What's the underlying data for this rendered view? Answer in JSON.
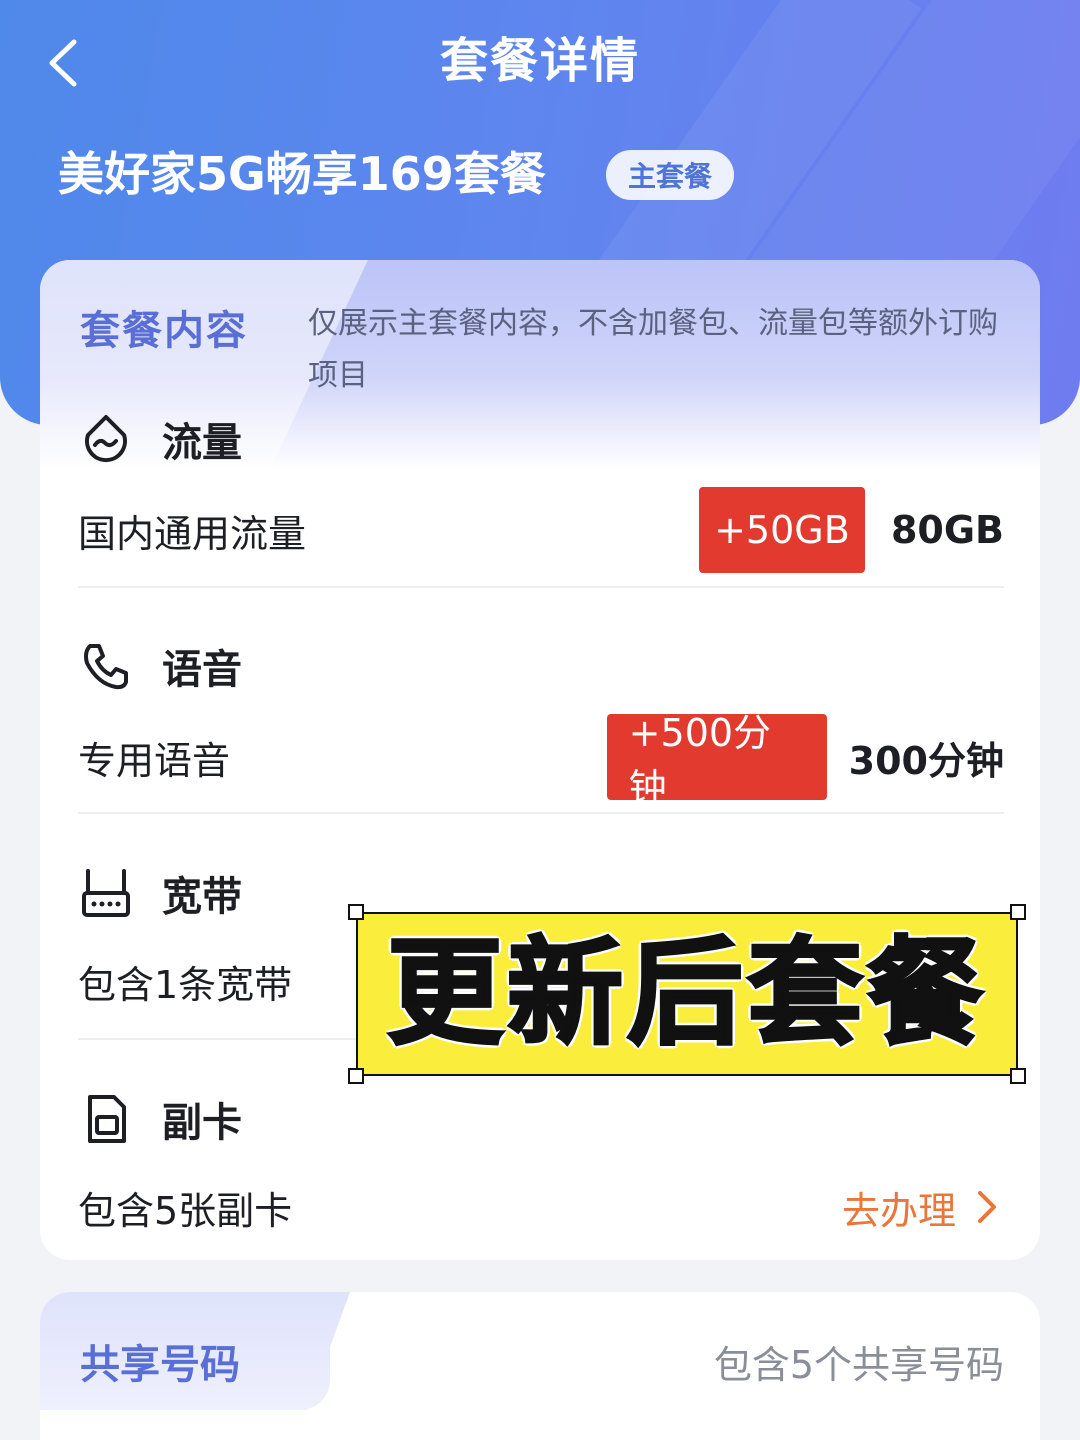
{
  "header": {
    "title": "套餐详情",
    "plan_name": "美好家5G畅享169套餐",
    "plan_tag": "主套餐"
  },
  "package": {
    "section_title": "套餐内容",
    "note": "仅展示主套餐内容，不含加餐包、流量包等额外订购项目",
    "data": {
      "label": "流量",
      "item_label": "国内通用流量",
      "bonus": "+50GB",
      "value": "80GB"
    },
    "voice": {
      "label": "语音",
      "item_label": "专用语音",
      "bonus": "+500分钟",
      "value": "300分钟"
    },
    "broadband": {
      "label": "宽带",
      "item_label": "包含1条宽带"
    },
    "sub_card": {
      "label": "副卡",
      "item_label": "包含5张副卡",
      "action": "去办理"
    }
  },
  "shared": {
    "title": "共享号码",
    "value": "包含5个共享号码"
  },
  "overlay": {
    "text": "更新后套餐"
  },
  "colors": {
    "header_gradient_start": "#4f89ea",
    "header_gradient_end": "#6f7cf0",
    "accent_red": "#e23a2e",
    "action_orange": "#e9773a",
    "section_title": "#5a6fd6",
    "overlay_yellow": "#fbed3b"
  },
  "icons": {
    "back": "chevron-left-icon",
    "data": "data-drop-icon",
    "voice": "phone-icon",
    "broadband": "router-icon",
    "sub_card": "sim-card-icon",
    "action": "chevron-right-icon"
  }
}
